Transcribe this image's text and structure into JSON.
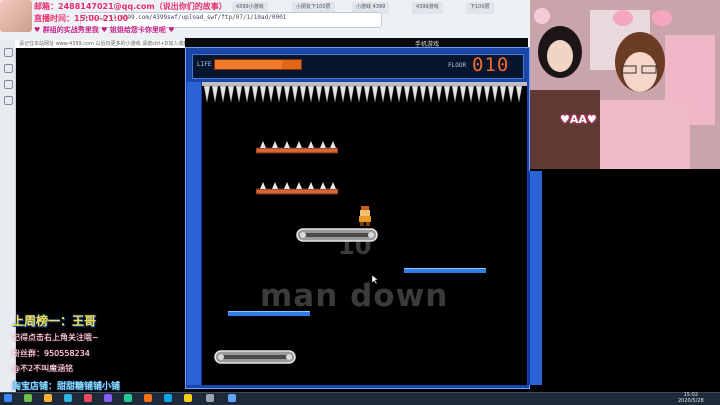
{
  "browser": {
    "url": "http://s1.4399.com/4399swf/upload_swf/ftp/07/1/10ad/0001",
    "tabs": [
      "4399小游戏",
      "小朋友下100层",
      "小游戏 4399",
      "4399游戏",
      "下100层"
    ],
    "page_strip_text": "请记住本站网址 www.4399.com 以后玩更多的小游戏 请按ctrl+D加入收藏"
  },
  "streamer_info": {
    "line1": "邮箱：2488147021@qq.com（说出你们的故事）",
    "line2": "直播时间：15:00-21:00",
    "line3": "♥ 群组的实战秀里我 ♥ 姐姐给您卡你里呢 ♥"
  },
  "game": {
    "title": "手机游戏",
    "life_label": "LIFE",
    "life_fraction": 0.78,
    "floor_label": "FLOOR",
    "floor_value": "010",
    "watermark_number": "10",
    "watermark_text": "man down"
  },
  "webcam": {
    "badge": "♥AA♥"
  },
  "overlay": {
    "title": "上周榜一：王哥",
    "line1": "记得点击右上角关注哦~",
    "line2": "粉丝群：950558234",
    "line3": "@不2不叫魔涵铭",
    "line4": "淘宝店铺：甜甜糖铺铺小铺"
  },
  "taskbar": {
    "time": "15:02",
    "date": "2020/5/28"
  },
  "colors": {
    "game_frame": "#1a46a8",
    "life_bar": "#e26618",
    "floor_value": "#f06a2a",
    "overlay_title": "#ffe04a",
    "overlay_shop": "#8ae0ff"
  }
}
